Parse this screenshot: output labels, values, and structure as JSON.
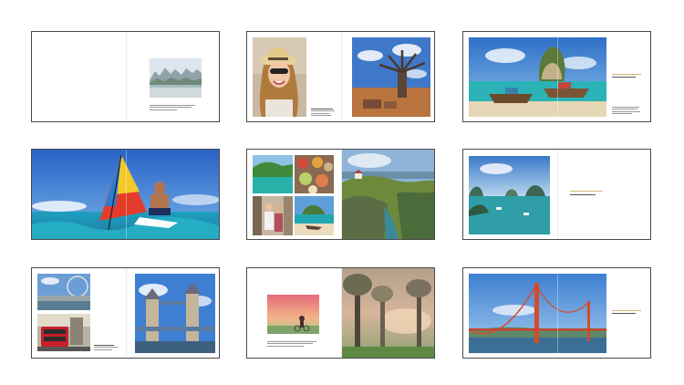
{
  "spreads": [
    {
      "id": "spread-1",
      "page_left": "",
      "page_right": ""
    },
    {
      "id": "spread-2",
      "page_left": "",
      "page_right": ""
    },
    {
      "id": "spread-3",
      "page_left": "",
      "page_right": ""
    },
    {
      "id": "spread-4",
      "page_left": "",
      "page_right": ""
    },
    {
      "id": "spread-5",
      "page_left": "",
      "page_right": ""
    },
    {
      "id": "spread-6",
      "page_left": "",
      "page_right": ""
    },
    {
      "id": "spread-7",
      "page_left": "",
      "page_right": ""
    },
    {
      "id": "spread-8",
      "page_left": "",
      "page_right": ""
    },
    {
      "id": "spread-9",
      "page_left": "",
      "page_right": ""
    }
  ],
  "colors": {
    "frame_border": "#4a4a4a",
    "caption_gold": "#d8b676",
    "body_text": "#9a9a9a",
    "background": "#ffffff"
  },
  "icons": {
    "photo": "photo-icon"
  }
}
